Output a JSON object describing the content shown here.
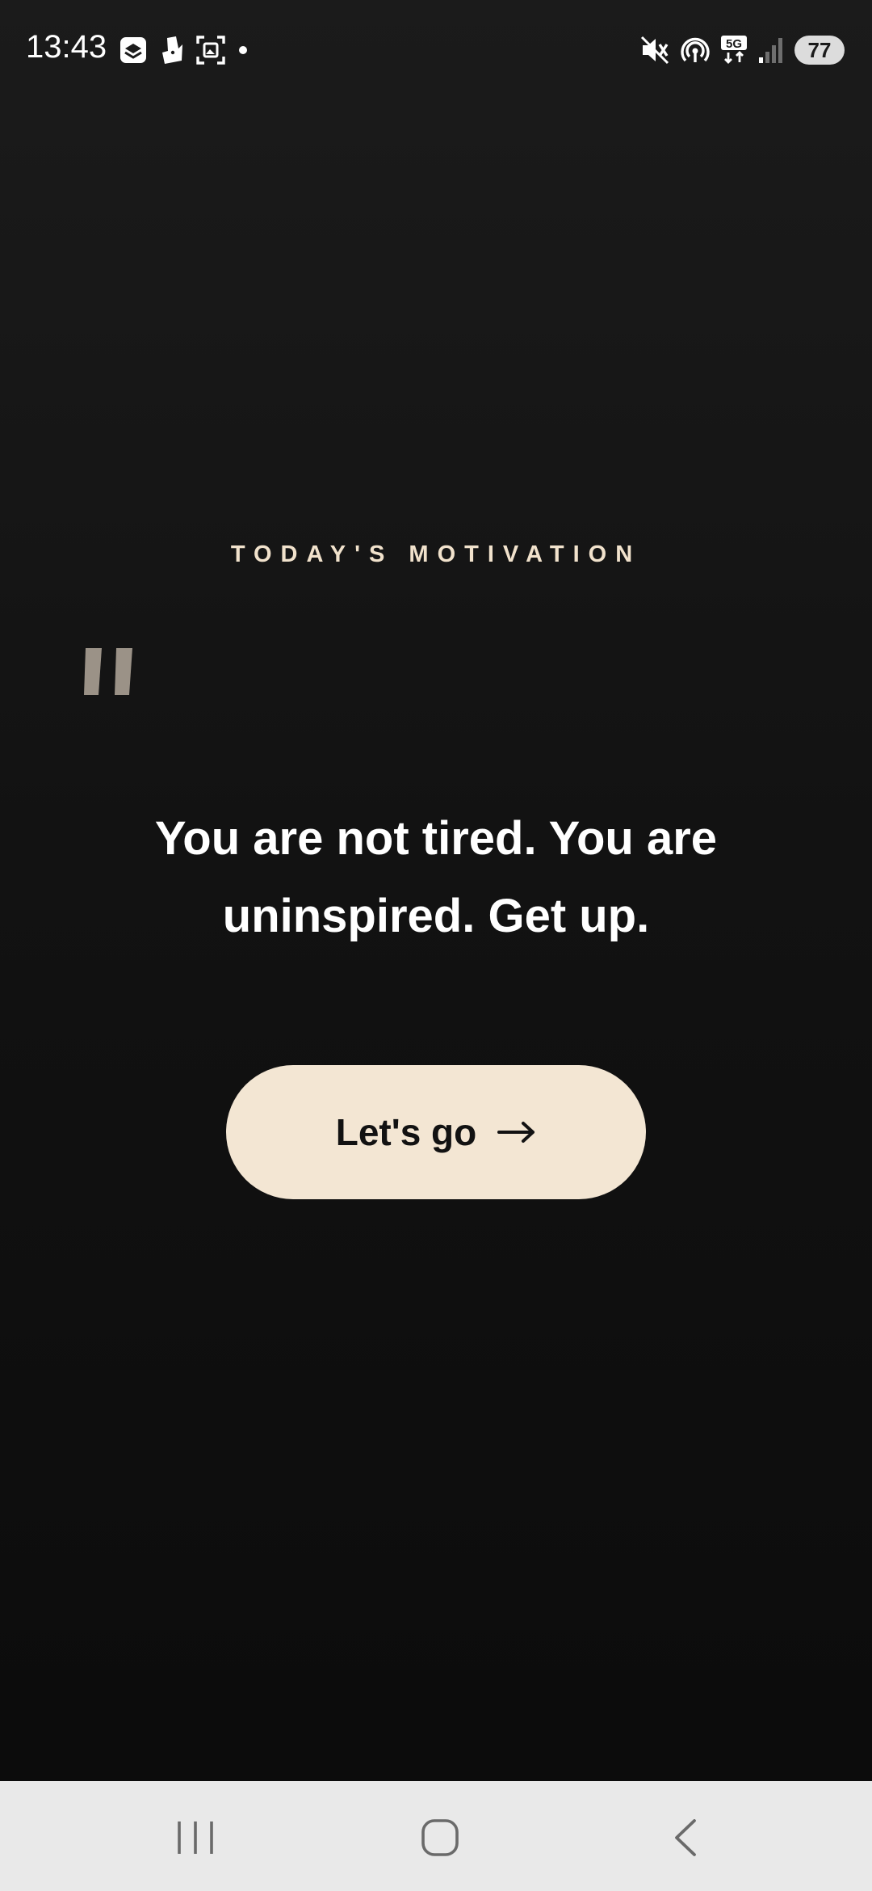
{
  "status_bar": {
    "time": "13:43",
    "left_icons": [
      "layers-app-icon",
      "deliveroo-icon",
      "screenshot-icon",
      "dot-icon"
    ],
    "right_icons": [
      "mute-icon",
      "hotspot-icon",
      "5g-icon",
      "signal-icon"
    ],
    "battery": "77"
  },
  "content": {
    "eyebrow": "TODAY'S MOTIVATION",
    "quote": "You are not tired. You are uninspired. Get up.",
    "button_label": "Let's go",
    "button_arrow": "→"
  },
  "nav_bar": {
    "buttons": [
      "recents-icon",
      "home-icon",
      "back-icon"
    ]
  },
  "colors": {
    "background_top": "#1b1b1b",
    "background_bottom": "#0b0b0b",
    "accent_cream": "#f3e6d3",
    "eyebrow_text": "#f1e2cc",
    "quote_mark": "#9b9287"
  }
}
